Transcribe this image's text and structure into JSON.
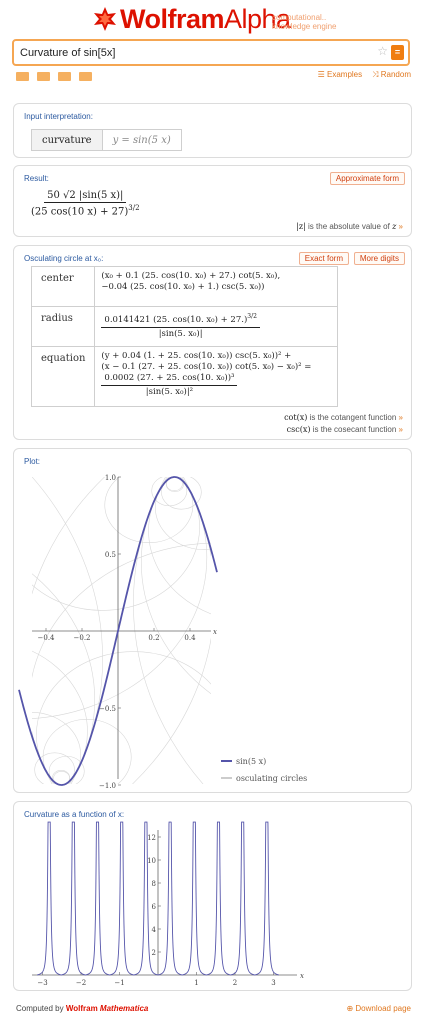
{
  "header": {
    "brand_wolfram": "Wolfram",
    "brand_alpha": "Alpha",
    "tagline_line1": "computational..",
    "tagline_line2": "knowledge engine",
    "query": "Curvature of sin[5x]",
    "examples_label": "Examples",
    "random_label": "Random"
  },
  "pods": {
    "input": {
      "title": "Input interpretation:",
      "left": "curvature",
      "right": "y = sin(5 x)"
    },
    "result": {
      "title": "Result:",
      "button": "Approximate form",
      "numerator": "50 √2 |sin(5 x)|",
      "denominator": "(25 cos(10 x) + 27)",
      "den_exp": "3/2",
      "note_sym": "|z|",
      "note_text": "is the absolute value of",
      "note_var": "z"
    },
    "osculating": {
      "title": "Osculating circle at x₀:",
      "button_exact": "Exact form",
      "button_more": "More digits",
      "rows": {
        "center_label": "center",
        "center_line1": "(x₀ + 0.1 (25. cos(10. x₀) + 27.) cot(5. x₀),",
        "center_line2": "−0.04 (25. cos(10. x₀) + 1.) csc(5. x₀))",
        "radius_label": "radius",
        "radius_num": "0.0141421 (25. cos(10. x₀) + 27.)",
        "radius_exp": "3/2",
        "radius_den": "|sin(5. x₀)|",
        "equation_label": "equation",
        "eq_line1": "(y + 0.04 (1. + 25. cos(10. x₀)) csc(5. x₀))² +",
        "eq_line2": "(x − 0.1 (27. + 25. cos(10. x₀)) cot(5. x₀) − x₀)² =",
        "eq_num": "0.0002 (27. + 25. cos(10. x₀))³",
        "eq_den": "|sin(5. x₀)|²"
      },
      "note1_sym": "cot(x)",
      "note1_text": "is the cotangent function",
      "note2_sym": "csc(x)",
      "note2_text": "is the cosecant function"
    },
    "plot": {
      "title": "Plot:",
      "legend_curve": "sin(5 x)",
      "legend_circles": "osculating circles"
    },
    "curvature": {
      "title": "Curvature as a function of x:"
    }
  },
  "footer": {
    "computed_by": "Computed by",
    "wolfram": "Wolfram",
    "mathematica": "Mathematica",
    "download": "Download page"
  },
  "colors": {
    "brand": "#dd1100",
    "accent": "#f07d10",
    "curve": "#5555aa",
    "circles": "#d8d8d8"
  },
  "chart_data": [
    {
      "type": "line",
      "name": "plot",
      "series": [
        {
          "name": "sin(5 x)",
          "function": "sin(5x)",
          "x_range": [
            -0.55,
            0.55
          ]
        },
        {
          "name": "osculating circles"
        }
      ],
      "xlim": [
        -0.5,
        0.5
      ],
      "ylim": [
        -1.0,
        1.0
      ],
      "x_ticks": [
        -0.4,
        -0.2,
        0.2,
        0.4
      ],
      "x_tick_labels": [
        "−0.4",
        "−0.2",
        "0.2",
        "0.4"
      ],
      "y_ticks": [
        -1.0,
        -0.5,
        0.5,
        1.0
      ],
      "y_tick_labels": [
        "−1.0",
        "−0.5",
        "0.5",
        "1.0"
      ],
      "xlabel": "x",
      "legend": "bottom-right"
    },
    {
      "type": "line",
      "name": "curvature",
      "series": [
        {
          "function": "50√2|sin(5x)|/(25cos(10x)+27)^(3/2)",
          "x_range": [
            -3.14,
            3.14
          ]
        }
      ],
      "xlim": [
        -3.3,
        3.3
      ],
      "ylim": [
        0,
        13
      ],
      "x_ticks": [
        -3,
        -2,
        -1,
        1,
        2,
        3
      ],
      "x_tick_labels": [
        "−3",
        "−2",
        "−1",
        "1",
        "2",
        "3"
      ],
      "y_ticks": [
        2,
        4,
        6,
        8,
        10,
        12
      ],
      "y_tick_labels": [
        "2",
        "4",
        "6",
        "8",
        "10",
        "12"
      ],
      "xlabel": "x"
    }
  ]
}
